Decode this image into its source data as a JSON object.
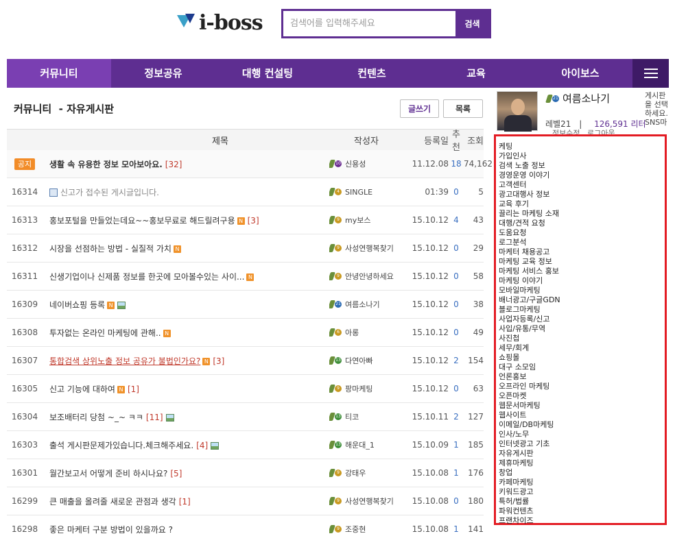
{
  "header": {
    "logo_text": "i-boss",
    "search_placeholder": "검색어를 입력해주세요",
    "search_button": "검색"
  },
  "nav": {
    "items": [
      "커뮤니티",
      "정보공유",
      "대행 컨설팅",
      "컨텐츠",
      "교육",
      "아이보스"
    ],
    "active_index": 0
  },
  "board": {
    "title": "커뮤니티  - 자유게시판",
    "write_button": "글쓰기",
    "list_button": "목록",
    "columns": {
      "title": "제목",
      "author": "작성자",
      "date": "등록일",
      "recommend": "추천",
      "views": "조회"
    }
  },
  "posts": [
    {
      "num": "공지",
      "notice": true,
      "title": "생활 속 유용한 정보 모아보아요.",
      "comments": "[32]",
      "author": "신용성",
      "level": "10",
      "date": "11.12.08",
      "rec": "18",
      "views": "74,162"
    },
    {
      "num": "16314",
      "title": "신고가 접수된 게시글입니다.",
      "reported": true,
      "author": "SINGLE",
      "level": "4",
      "date": "01:39",
      "rec": "0",
      "views": "5"
    },
    {
      "num": "16313",
      "title": "홍보포털을 만들었는데요~~홍보무료로 해드릴려구용",
      "new": true,
      "comments": "[3]",
      "author": "my보스",
      "level": "9",
      "date": "15.10.12",
      "rec": "4",
      "views": "43"
    },
    {
      "num": "16312",
      "title": "시장을 선점하는 방법 - 실질적 가치",
      "new": true,
      "author": "사성연행복찾기",
      "level": "9",
      "date": "15.10.12",
      "rec": "0",
      "views": "29"
    },
    {
      "num": "16311",
      "title": "신생기업이나 신제품 정보를 한곳에 모아볼수있는 사이...",
      "new": true,
      "author": "안녕안녕하세요",
      "level": "9",
      "date": "15.10.12",
      "rec": "0",
      "views": "58"
    },
    {
      "num": "16309",
      "title": "네이버쇼핑 등록",
      "new": true,
      "image": true,
      "author": "여름소나기",
      "level": "21",
      "date": "15.10.12",
      "rec": "0",
      "views": "38"
    },
    {
      "num": "16308",
      "title": "투자없는 온라인 마케팅에 관해..",
      "new": true,
      "author": "아롱",
      "level": "6",
      "date": "15.10.12",
      "rec": "0",
      "views": "49"
    },
    {
      "num": "16307",
      "title": "통합검색 상위노출 정보 공유가 불법인가요?",
      "red": true,
      "new": true,
      "comments": "[3]",
      "author": "다연아빠",
      "level": "13",
      "date": "15.10.12",
      "rec": "2",
      "views": "154"
    },
    {
      "num": "16305",
      "title": "신고 기능에 대하여",
      "new": true,
      "comments": "[1]",
      "author": "팡마케팅",
      "level": "9",
      "date": "15.10.12",
      "rec": "0",
      "views": "63"
    },
    {
      "num": "16304",
      "title": "보조배터리 당첨 ~_~ ㅋㅋ",
      "comments": "[11]",
      "image": true,
      "author": "티코",
      "level": "13",
      "date": "15.10.11",
      "rec": "2",
      "views": "127"
    },
    {
      "num": "16303",
      "title": "출석 게시판문제가있습니다.체크해주세요.",
      "comments": "[4]",
      "image": true,
      "author": "해운대_1",
      "level": "13",
      "date": "15.10.09",
      "rec": "1",
      "views": "185"
    },
    {
      "num": "16301",
      "title": "월간보고서 어떻게 준비 하시나요?",
      "comments": "[5]",
      "author": "강태우",
      "level": "9",
      "date": "15.10.08",
      "rec": "1",
      "views": "176"
    },
    {
      "num": "16299",
      "title": "큰 매출을 올려줄 새로운 관점과 생각",
      "comments": "[1]",
      "author": "사성연행복찾기",
      "level": "9",
      "date": "15.10.08",
      "rec": "0",
      "views": "180"
    },
    {
      "num": "16298",
      "title": "좋은 마케터 구분 방법이 있을까요 ?",
      "author": "조중현",
      "level": "9",
      "date": "15.10.08",
      "rec": "1",
      "views": "141"
    }
  ],
  "profile": {
    "name": "여름소나기",
    "level_badge": "21",
    "stats": "레벨21  |  126,591 리터",
    "level_text": "레벨21",
    "separator": "|",
    "points": "126,591 리터",
    "links": "정보수정   로그아웃",
    "side_note": "게시판을 선택하세요. SNS마"
  },
  "categories": [
    "케팅",
    "가입인사",
    "검색 노출 정보",
    "경영운영 이야기",
    "고객센터",
    "광고대행사 정보",
    "교육 후기",
    "끌리는 마케팅 소재",
    "대행/견적 요청",
    "도움요청",
    "로그분석",
    "마케터 채용공고",
    "마케팅 교육 정보",
    "마케팅 서비스 홍보",
    "마케팅 이야기",
    "모바일마케팅",
    "배너광고/구글GDN",
    "블로그마케팅",
    "사업자등록/신고",
    "사입/유통/무역",
    "사진첩",
    "세무/회계",
    "쇼핑몰",
    "대구 소모임",
    "언론홍보",
    "오프라인 마케팅",
    "오픈마켓",
    "웹문서마케팅",
    "웹사이트",
    "이메일/DB마케팅",
    "인사/노무",
    "인터넷광고 기초",
    "자유게시판",
    "제휴마케팅",
    "창업",
    "카페마케팅",
    "키워드광고",
    "특허/법률",
    "파워컨텐츠",
    "프랜차이즈"
  ],
  "colors": {
    "brand": "#5e2e91",
    "nav_active": "#7a3fb2",
    "highlight_border": "#e31b23",
    "notice": "#f28c28"
  }
}
